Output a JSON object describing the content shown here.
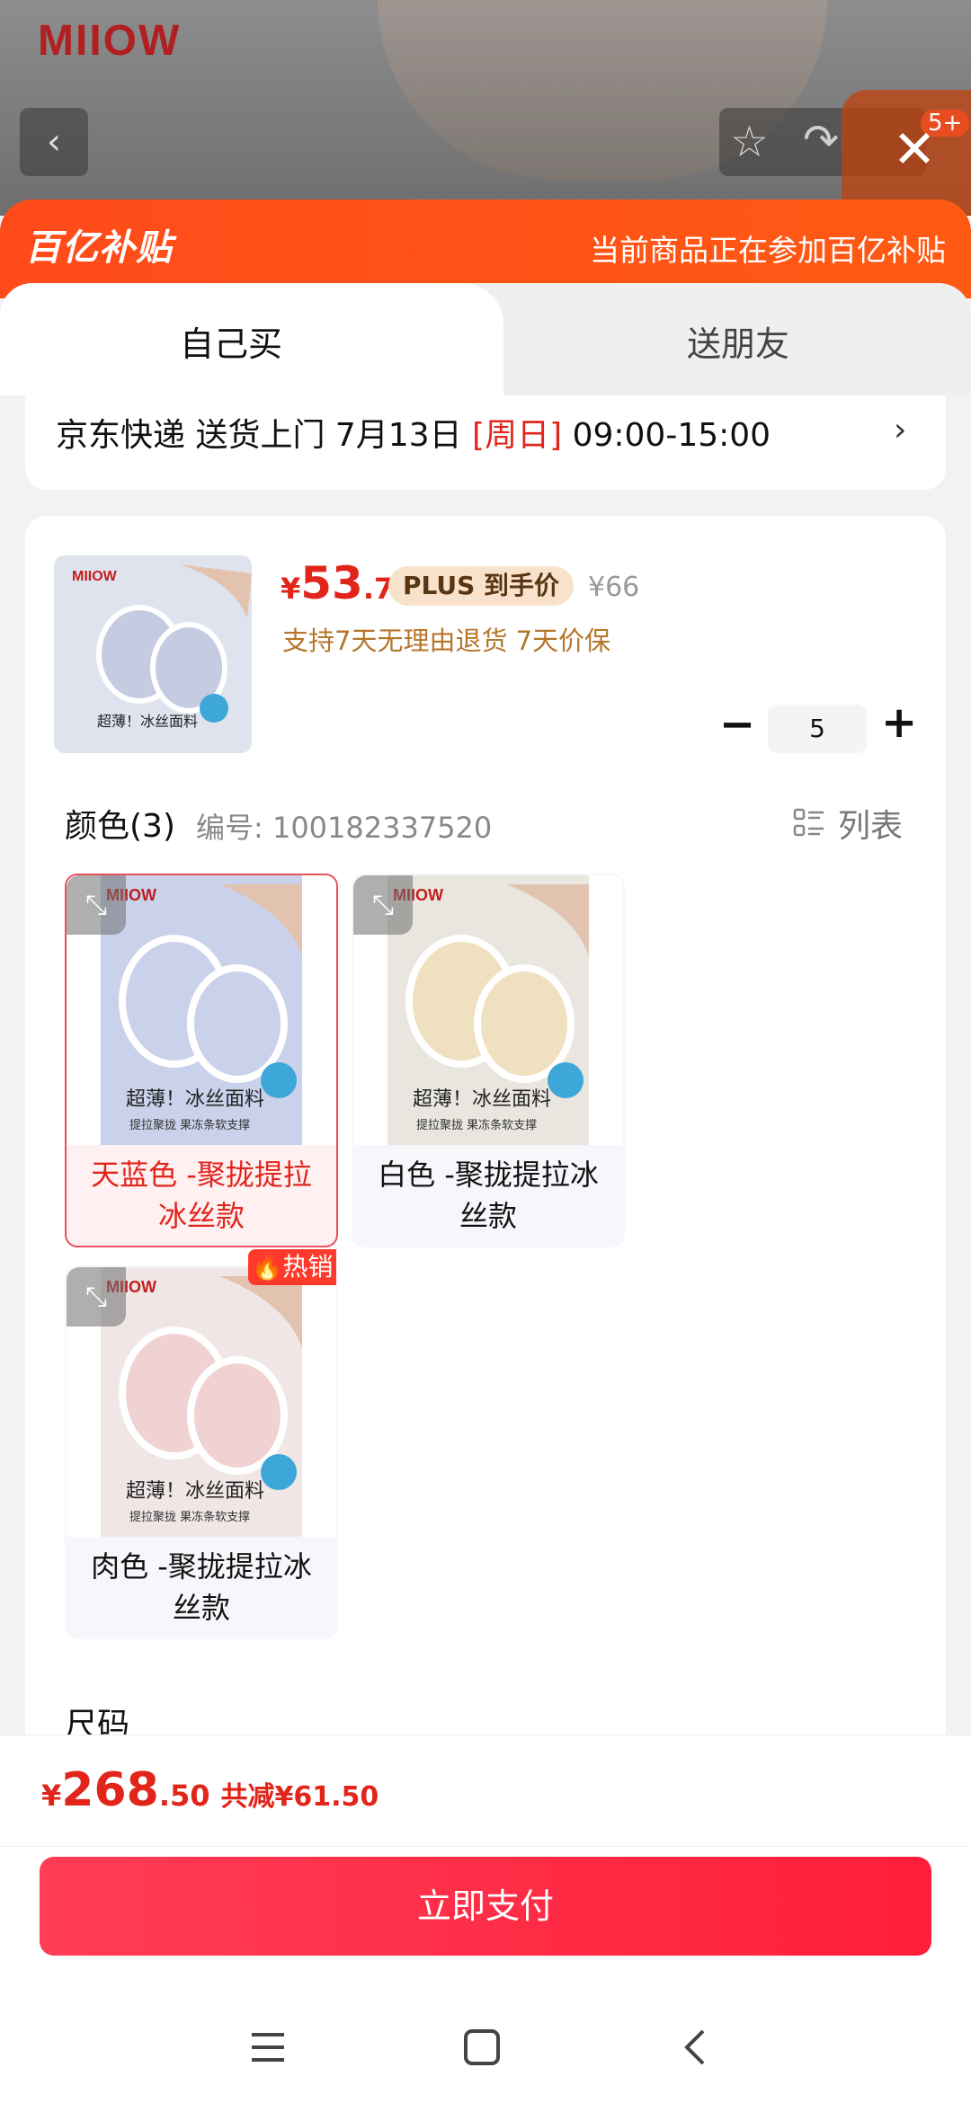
{
  "background": {
    "brand_logo": "MIIOW",
    "cart_count": "5+"
  },
  "banner": {
    "logo": "百亿补贴",
    "notice": "当前商品正在参加百亿补贴"
  },
  "tabs": [
    {
      "label": "自己买",
      "active": true
    },
    {
      "label": "送朋友",
      "active": false
    }
  ],
  "delivery": {
    "prefix": "京东快递 送货上门 7月13日 ",
    "weekday": "[周日]",
    "time": " 09:00-15:00",
    "arrow": "›"
  },
  "product": {
    "currency": "¥",
    "price_int": "53",
    "price_dec": ".7",
    "plus_tag": "PLUS 到手价",
    "original_price": "¥66",
    "service": "支持7天无理由退货  7天价保",
    "quantity": "5",
    "minus": "−",
    "plus": "+"
  },
  "color_section": {
    "title": "颜色(3)",
    "sku_number": "编号: 100182337520",
    "list_toggle": "列表"
  },
  "options": [
    {
      "label": "天蓝色 -聚拢提拉冰丝款",
      "selected": true,
      "img_text": "超薄！冰丝面料",
      "img_sub": "提拉聚拢  果冻条软支撑",
      "tone": "#c9d2ea"
    },
    {
      "label": "白色 -聚拢提拉冰丝款",
      "selected": false,
      "img_text": "超薄！冰丝面料",
      "img_sub": "提拉聚拢  果冻条软支撑",
      "tone": "#efe0bf"
    },
    {
      "label": "肉色 -聚拢提拉冰丝款",
      "selected": false,
      "img_text": "超薄！冰丝面料",
      "img_sub": "提拉聚拢  果冻条软支撑",
      "tone": "#f0d2d2"
    }
  ],
  "hot_badge": "热销",
  "size_section": {
    "title": "尺码"
  },
  "footer": {
    "currency": "¥",
    "total_int": "268",
    "total_dec": ".50",
    "discount": "共减¥61.50",
    "pay_button": "立即支付"
  },
  "colors": {
    "accent_red": "#e1251b",
    "banner_orange": "#ff4b1a",
    "pay_button": "#ff2a45"
  }
}
